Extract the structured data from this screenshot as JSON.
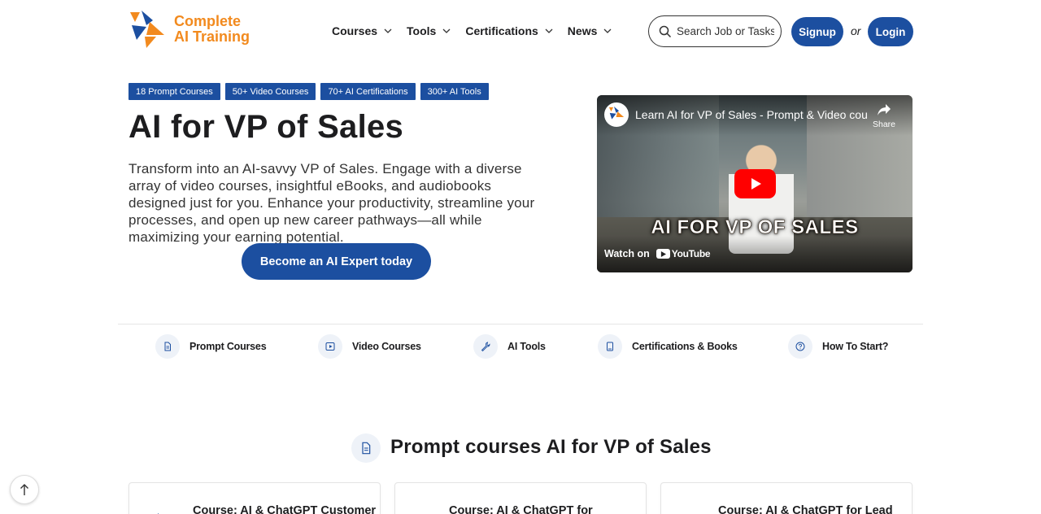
{
  "header": {
    "logo_line1": "Complete",
    "logo_line2": "AI Training",
    "nav": [
      {
        "label": "Courses"
      },
      {
        "label": "Tools"
      },
      {
        "label": "Certifications"
      },
      {
        "label": "News"
      }
    ],
    "search_placeholder": "Search Job or Tasks",
    "signup_label": "Signup",
    "or_text": "or",
    "login_label": "Login"
  },
  "hero": {
    "badges": [
      "18 Prompt Courses",
      "50+ Video Courses",
      "70+ AI Certifications",
      "300+ AI Tools"
    ],
    "title": "AI for VP of Sales",
    "description": "Transform into an AI-savvy VP of Sales. Engage with a diverse array of video courses, insightful eBooks, and audiobooks designed just for you. Enhance your productivity, streamline your processes, and open up new career pathways—all while maximizing your earning potential.",
    "cta_label": "Become an AI Expert today"
  },
  "video": {
    "title": "Learn AI for VP of Sales - Prompt & Video cou...",
    "share_label": "Share",
    "overlay_title": "AI FOR VP OF SALES",
    "watch_on": "Watch on",
    "youtube_label": "YouTube"
  },
  "categories": [
    {
      "label": "Prompt Courses",
      "icon": "document-icon"
    },
    {
      "label": "Video Courses",
      "icon": "play-icon"
    },
    {
      "label": "AI Tools",
      "icon": "wrench-icon"
    },
    {
      "label": "Certifications & Books",
      "icon": "book-icon"
    },
    {
      "label": "How To Start?",
      "icon": "question-icon"
    }
  ],
  "section": {
    "title": "Prompt courses AI for VP of Sales"
  },
  "cards": [
    {
      "title": "Course: AI & ChatGPT Customer"
    },
    {
      "title": "Course: AI & ChatGPT for"
    },
    {
      "title": "Course: AI & ChatGPT for Lead"
    }
  ],
  "colors": {
    "brand_blue": "#1c4fa0",
    "brand_orange": "#f28a1e",
    "youtube_red": "#ff0000"
  }
}
